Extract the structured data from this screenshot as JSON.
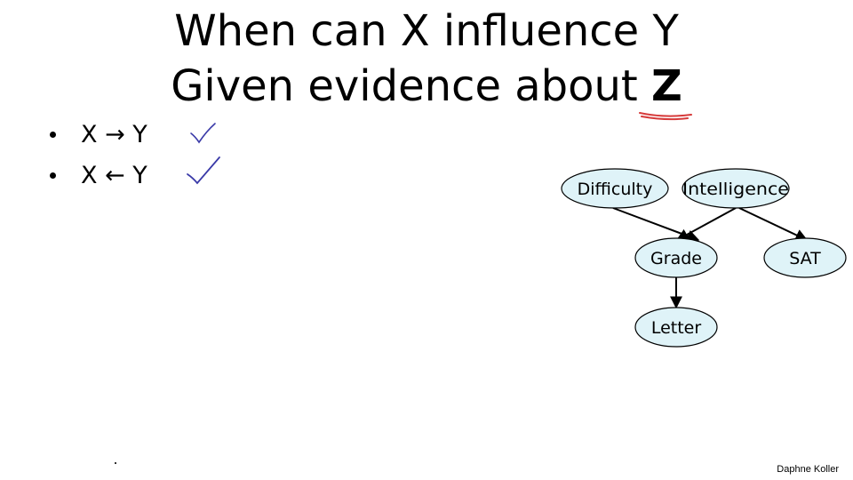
{
  "title": {
    "line1": "When can X influence Y",
    "line2_prefix": "Given evidence about ",
    "line2_emphasis": "Z"
  },
  "bullets": [
    {
      "text": "X → Y",
      "mark": "✓"
    },
    {
      "text": "X ← Y",
      "mark": "✓"
    }
  ],
  "diagram": {
    "nodes": {
      "difficulty": "Difficulty",
      "intelligence": "Intelligence",
      "grade": "Grade",
      "sat": "SAT",
      "letter": "Letter"
    },
    "edges": [
      [
        "Difficulty",
        "Grade"
      ],
      [
        "Intelligence",
        "Grade"
      ],
      [
        "Intelligence",
        "SAT"
      ],
      [
        "Grade",
        "Letter"
      ]
    ],
    "node_fill": "#dff3f8"
  },
  "annotations": {
    "check_color": "#3a3aa8",
    "underline_color": "#d63a3a"
  },
  "footer": {
    "author": "Daphne Koller"
  }
}
